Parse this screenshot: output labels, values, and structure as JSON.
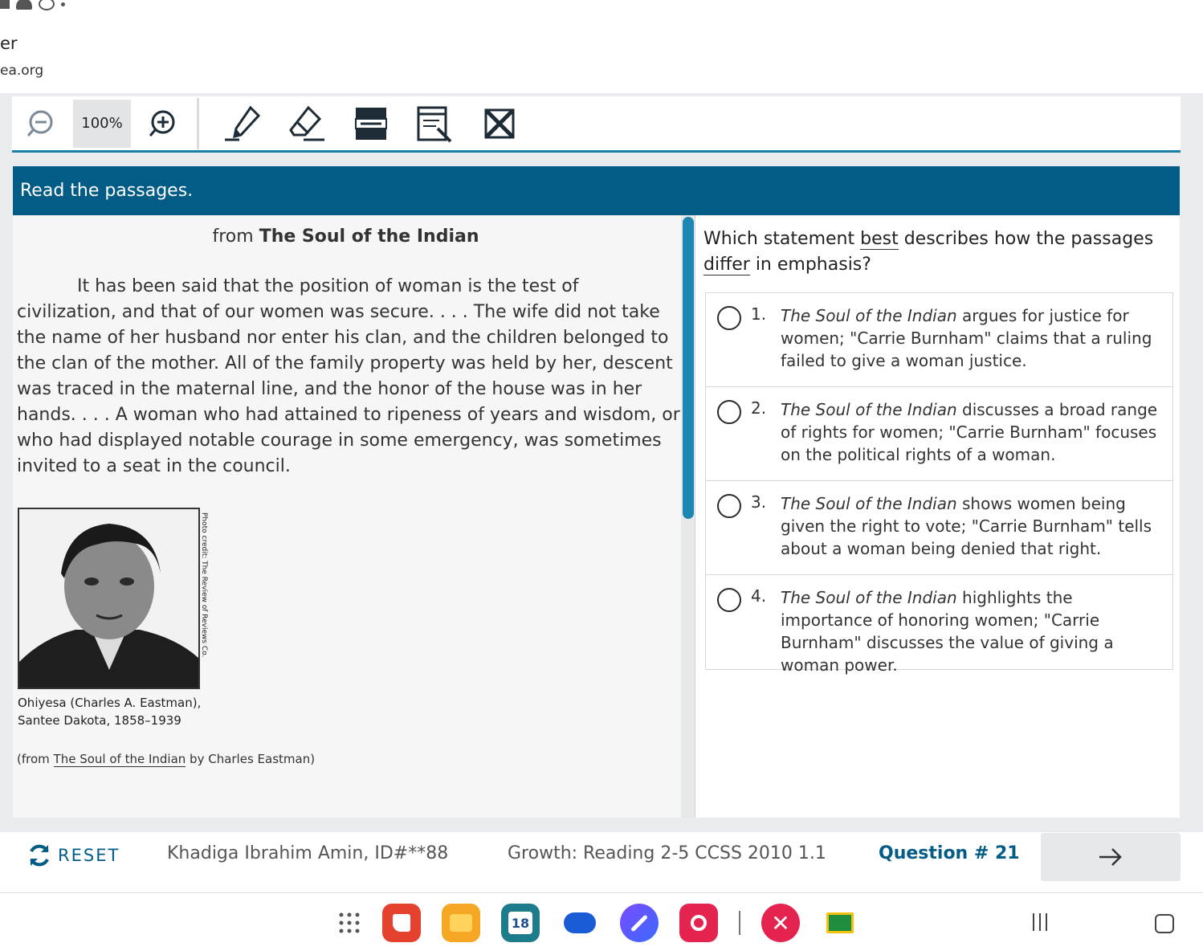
{
  "browser": {
    "title_fragment": "er",
    "url_fragment": "ea.org"
  },
  "toolbar": {
    "zoom_value": "100%",
    "zoom_out_icon": "zoom-out-icon",
    "zoom_in_icon": "zoom-in-icon",
    "tools": [
      "highlighter-icon",
      "eraser-icon",
      "line-reader-icon",
      "notepad-icon",
      "answer-eliminator-icon"
    ]
  },
  "banner": {
    "text": "Read the passages."
  },
  "passage": {
    "title_prefix": "from ",
    "title_bold": "The Soul of the Indian",
    "paragraph": "It has been said that the position of woman is the test of civilization, and that of our women was secure. . . . The wife did not take the name of her husband nor enter his clan, and the children belonged to the clan of the mother. All of the family property was held by her, descent was traced in the maternal line, and the honor of the house was in her hands. . . . A woman who had attained to ripeness of years and wisdom, or who had displayed notable courage in some emergency, was sometimes invited to a seat in the council.",
    "photo_credit": "Photo credit: The Review of Reviews Co.",
    "caption_line1": "Ohiyesa (Charles A. Eastman),",
    "caption_line2": "Santee Dakota, 1858–1939",
    "source_prefix": "(from ",
    "source_title": "The Soul of the Indian",
    "source_suffix": " by Charles Eastman)"
  },
  "question": {
    "part1": "Which statement ",
    "underlined1": "best",
    "part2": " describes how the passages ",
    "underlined2": "differ",
    "part3": " in emphasis?",
    "options": [
      {
        "num": "1.",
        "italic": "The Soul of the Indian",
        "text": " argues for justice for women; \"Carrie Burnham\" claims that a ruling failed to give a woman justice."
      },
      {
        "num": "2.",
        "italic": "The Soul of the Indian",
        "text": " discusses a broad range of rights for women; \"Carrie Burnham\" focuses on the political rights of a woman."
      },
      {
        "num": "3.",
        "italic": "The Soul of the Indian",
        "text": " shows women being given the right to vote; \"Carrie Burnham\" tells about a woman being denied that right."
      },
      {
        "num": "4.",
        "italic": "The Soul of the Indian",
        "text": " highlights the importance of honoring women; \"Carrie Burnham\" discusses the value of giving a woman power."
      }
    ]
  },
  "footer": {
    "reset_label": "RESET",
    "student": "Khadiga Ibrahim Amin, ID#**88",
    "test_name": "Growth: Reading 2-5 CCSS 2010 1.1",
    "question_number": "Question # 21"
  },
  "dock": {
    "calendar_day": "18"
  },
  "colors": {
    "brand": "#035c85",
    "accent": "#1b7fa6"
  }
}
